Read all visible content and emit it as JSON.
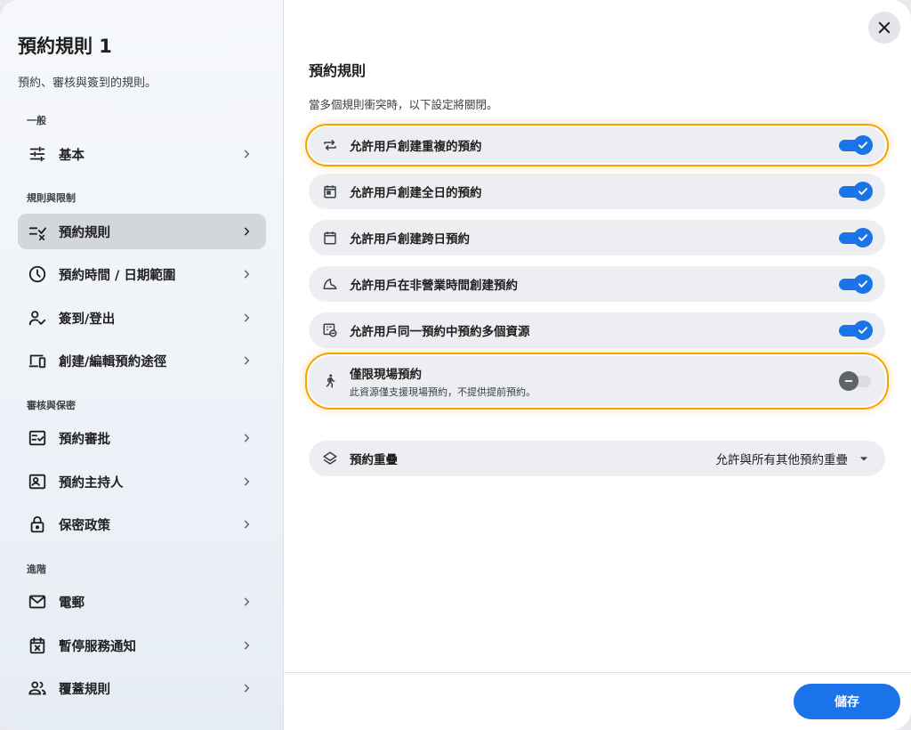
{
  "sidebar": {
    "title": "預約規則 1",
    "subtitle": "預約、審核與簽到的規則。",
    "sections": {
      "general": "一般",
      "rules": "規則與限制",
      "review": "審核與保密",
      "advanced": "進階"
    },
    "items": [
      {
        "label": "基本",
        "icon": "tune-icon"
      },
      {
        "label": "預約規則",
        "icon": "rule-checklist-icon",
        "active": true
      },
      {
        "label": "預約時間 / 日期範圍",
        "icon": "clock-icon"
      },
      {
        "label": "簽到/登出",
        "icon": "person-check-icon"
      },
      {
        "label": "創建/編輯預約途徑",
        "icon": "devices-icon"
      },
      {
        "label": "預約審批",
        "icon": "approval-list-icon"
      },
      {
        "label": "預約主持人",
        "icon": "host-badge-icon"
      },
      {
        "label": "保密政策",
        "icon": "lock-icon"
      },
      {
        "label": "電郵",
        "icon": "mail-icon"
      },
      {
        "label": "暫停服務通知",
        "icon": "calendar-x-icon"
      },
      {
        "label": "覆蓋規則",
        "icon": "group-icon"
      }
    ]
  },
  "main": {
    "title": "預約規則",
    "description": "當多個規則衝突時，以下設定將關閉。",
    "rules": [
      {
        "label": "允許用戶創建重複的預約",
        "icon": "repeat-icon",
        "enabled": true
      },
      {
        "label": "允許用戶創建全日的預約",
        "icon": "calendar-day-icon",
        "enabled": true
      },
      {
        "label": "允許用戶創建跨日預約",
        "icon": "calendar-icon",
        "enabled": true
      },
      {
        "label": "允許用戶在非營業時間創建預約",
        "icon": "moon-icon",
        "enabled": true
      },
      {
        "label": "允許用戶同一預約中預約多個資源",
        "icon": "multi-resource-icon",
        "enabled": true
      },
      {
        "label": "僅限現場預約",
        "sublabel": "此資源僅支援現場預約，不提供提前預約。",
        "icon": "walk-icon",
        "enabled": false
      }
    ],
    "overlap": {
      "label": "預約重疊",
      "icon": "layers-icon",
      "value": "允許與所有其他預約重疊"
    },
    "save_label": "儲存"
  },
  "colors": {
    "accent": "#1a73e8",
    "highlight": "#f5a300"
  }
}
